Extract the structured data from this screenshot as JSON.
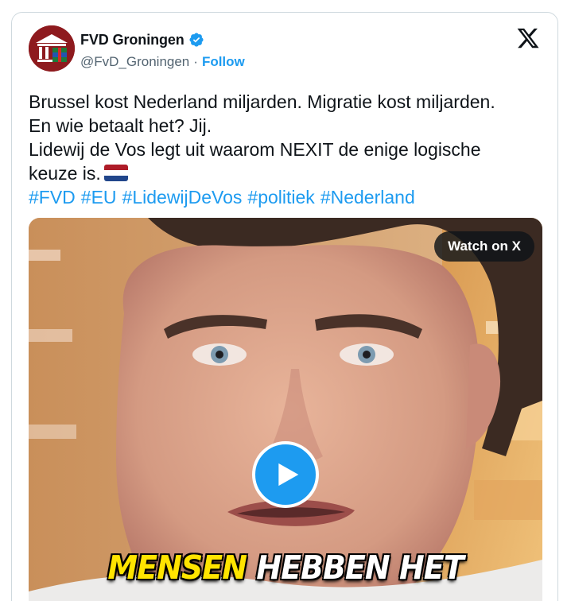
{
  "post": {
    "author": {
      "display_name": "FVD Groningen",
      "handle": "@FvD_Groningen",
      "separator": "·",
      "follow_label": "Follow",
      "verified": true,
      "avatar_icon": "fvd-groningen-logo"
    },
    "platform_icon": "x-logo-icon",
    "text_lines": [
      "Brussel kost Nederland miljarden. Migratie kost miljarden.",
      "En wie betaalt het? Jij.",
      "Lidewij de Vos legt uit waarom NEXIT de enige logische",
      "keuze is."
    ],
    "flag_emoji": "netherlands-flag",
    "hashtags": [
      "#FVD",
      "#EU",
      "#LidewijDeVos",
      "#politiek",
      "#Nederland"
    ],
    "media": {
      "watch_label": "Watch on X",
      "play_icon": "play-icon",
      "caption_highlight": "MENSEN",
      "caption_rest": "HEBBEN HET"
    },
    "colors": {
      "link": "#1d9bf0",
      "text": "#0f1419",
      "muted": "#536471",
      "border": "#cfd9de",
      "caption_highlight": "#ffe400"
    }
  }
}
